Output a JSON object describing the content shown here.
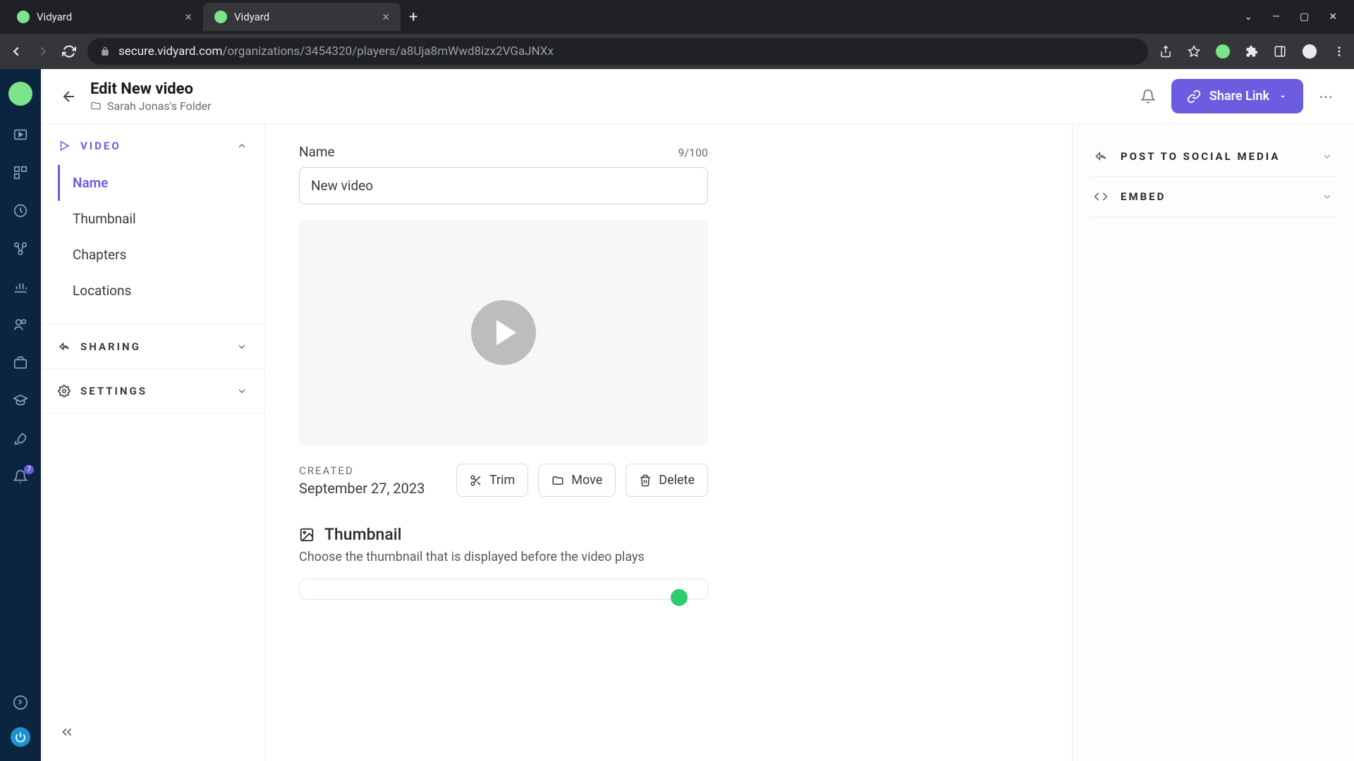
{
  "browser": {
    "tabs": [
      {
        "title": "Vidyard",
        "active": false
      },
      {
        "title": "Vidyard",
        "active": true
      }
    ],
    "url_domain": "secure.vidyard.com",
    "url_path": "/organizations/3454320/players/a8Uja8mWwd8izx2VGaJNXx"
  },
  "header": {
    "title": "Edit New video",
    "folder": "Sarah Jonas's Folder",
    "share_label": "Share Link"
  },
  "sidebar": {
    "sections": {
      "video": {
        "title": "VIDEO",
        "items": [
          "Name",
          "Thumbnail",
          "Chapters",
          "Locations"
        ],
        "active_index": 0
      },
      "sharing": {
        "title": "SHARING"
      },
      "settings": {
        "title": "SETTINGS"
      }
    }
  },
  "main": {
    "name_label": "Name",
    "name_count": "9/100",
    "name_value": "New video",
    "created_label": "CREATED",
    "created_value": "September 27, 2023",
    "actions": {
      "trim": "Trim",
      "move": "Move",
      "delete": "Delete"
    },
    "thumbnail_title": "Thumbnail",
    "thumbnail_desc": "Choose the thumbnail that is displayed before the video plays"
  },
  "right_panel": {
    "post_social": "POST TO SOCIAL MEDIA",
    "embed": "EMBED"
  },
  "rail": {
    "notif_count": "7"
  }
}
